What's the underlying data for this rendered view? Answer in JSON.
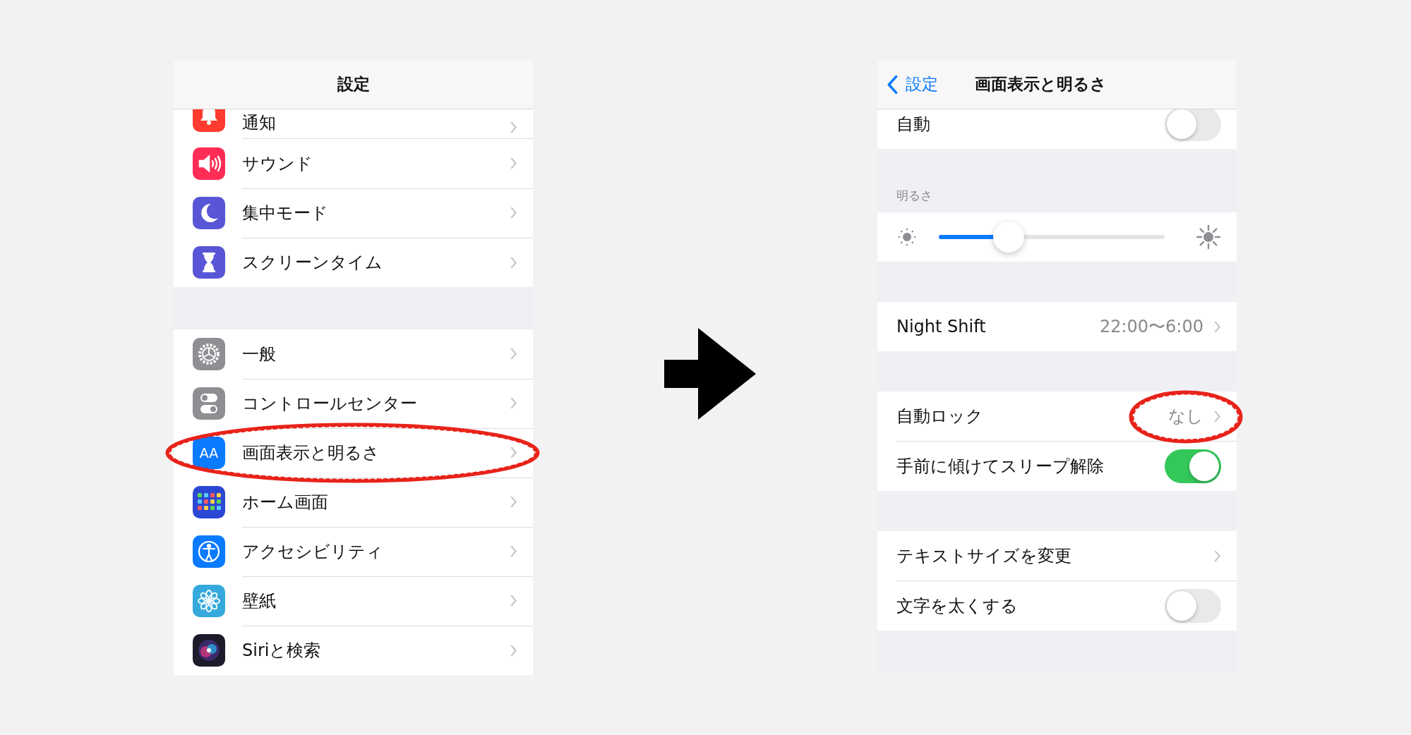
{
  "left_panel": {
    "title": "設定",
    "sections": [
      {
        "items": [
          {
            "label": "通知",
            "kind": "bell",
            "color": "#ff3b30",
            "highlighted": false
          },
          {
            "label": "サウンド",
            "kind": "speaker",
            "color": "#ff2d55",
            "highlighted": false
          },
          {
            "label": "集中モード",
            "kind": "moon",
            "color": "#5856d6",
            "highlighted": false
          },
          {
            "label": "スクリーンタイム",
            "kind": "hourglass",
            "color": "#5856d6",
            "highlighted": false
          }
        ]
      },
      {
        "items": [
          {
            "label": "一般",
            "kind": "gear",
            "color": "#8e8e93",
            "highlighted": false
          },
          {
            "label": "コントロールセンター",
            "kind": "switches",
            "color": "#8e8e93",
            "highlighted": false
          },
          {
            "label": "画面表示と明るさ",
            "kind": "letters",
            "glyph": "AA",
            "color": "#0a7aff",
            "highlighted": true
          },
          {
            "label": "ホーム画面",
            "kind": "grid",
            "color": "#2c47d4",
            "highlighted": false
          },
          {
            "label": "アクセシビリティ",
            "kind": "person",
            "color": "#0a7aff",
            "highlighted": false
          },
          {
            "label": "壁紙",
            "kind": "flower",
            "color": "#36a9dc",
            "highlighted": false
          },
          {
            "label": "Siriと検索",
            "kind": "orb",
            "color": "#1b1b2a",
            "highlighted": false
          }
        ]
      }
    ]
  },
  "right_panel": {
    "back_label": "設定",
    "title": "画面表示と明るさ",
    "sections": [
      {
        "rows": [
          {
            "kind": "toggle",
            "label": "自動",
            "on": false
          }
        ]
      },
      {
        "header": "明るさ",
        "rows": [
          {
            "kind": "slider",
            "level": 0.31
          }
        ]
      },
      {
        "rows": [
          {
            "kind": "value",
            "label": "Night Shift",
            "value": "22:00〜6:00",
            "highlighted": false
          }
        ]
      },
      {
        "rows": [
          {
            "kind": "value",
            "label": "自動ロック",
            "value": "なし",
            "highlighted": true
          },
          {
            "kind": "toggle",
            "label": "手前に傾けてスリープ解除",
            "on": true
          }
        ]
      },
      {
        "rows": [
          {
            "kind": "link",
            "label": "テキストサイズを変更"
          },
          {
            "kind": "toggle",
            "label": "文字を太くする",
            "on": false
          }
        ]
      }
    ]
  }
}
